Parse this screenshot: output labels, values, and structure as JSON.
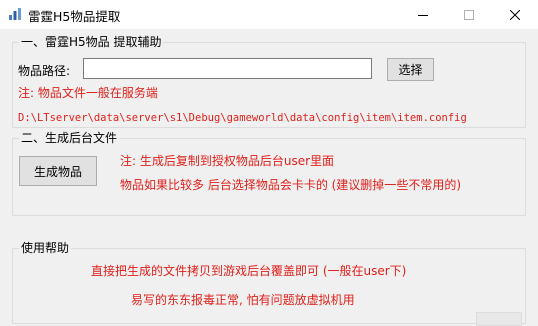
{
  "window": {
    "title": "雷霆H5物品提取",
    "icon": "bar-chart-icon"
  },
  "controls": {
    "minimize": "minimize-icon",
    "maximize": "maximize-icon",
    "close": "close-icon"
  },
  "section1": {
    "legend": "一、雷霆H5物品 提取辅助",
    "path_label": "物品路径:",
    "path_value": "",
    "select_button": "选择",
    "note": "注: 物品文件一般在服务端",
    "path_hint": "D:\\LTserver\\data\\server\\s1\\Debug\\gameworld\\data\\config\\item\\item.config"
  },
  "section2": {
    "legend": "二、生成后台文件",
    "generate_button": "生成物品",
    "note_line1": "注: 生成后复制到授权物品后台user里面",
    "note_line2": "物品如果比较多 后台选择物品会卡卡的 (建议删掉一些不常用的)"
  },
  "section3": {
    "legend": "使用帮助",
    "line1": "直接把生成的文件拷贝到游戏后台覆盖即可 (一般在user下)",
    "line2": "易写的东东报毒正常, 怕有问题放虚拟机用"
  },
  "colors": {
    "note_red": "#e0201b",
    "background": "#f0f0f0"
  }
}
